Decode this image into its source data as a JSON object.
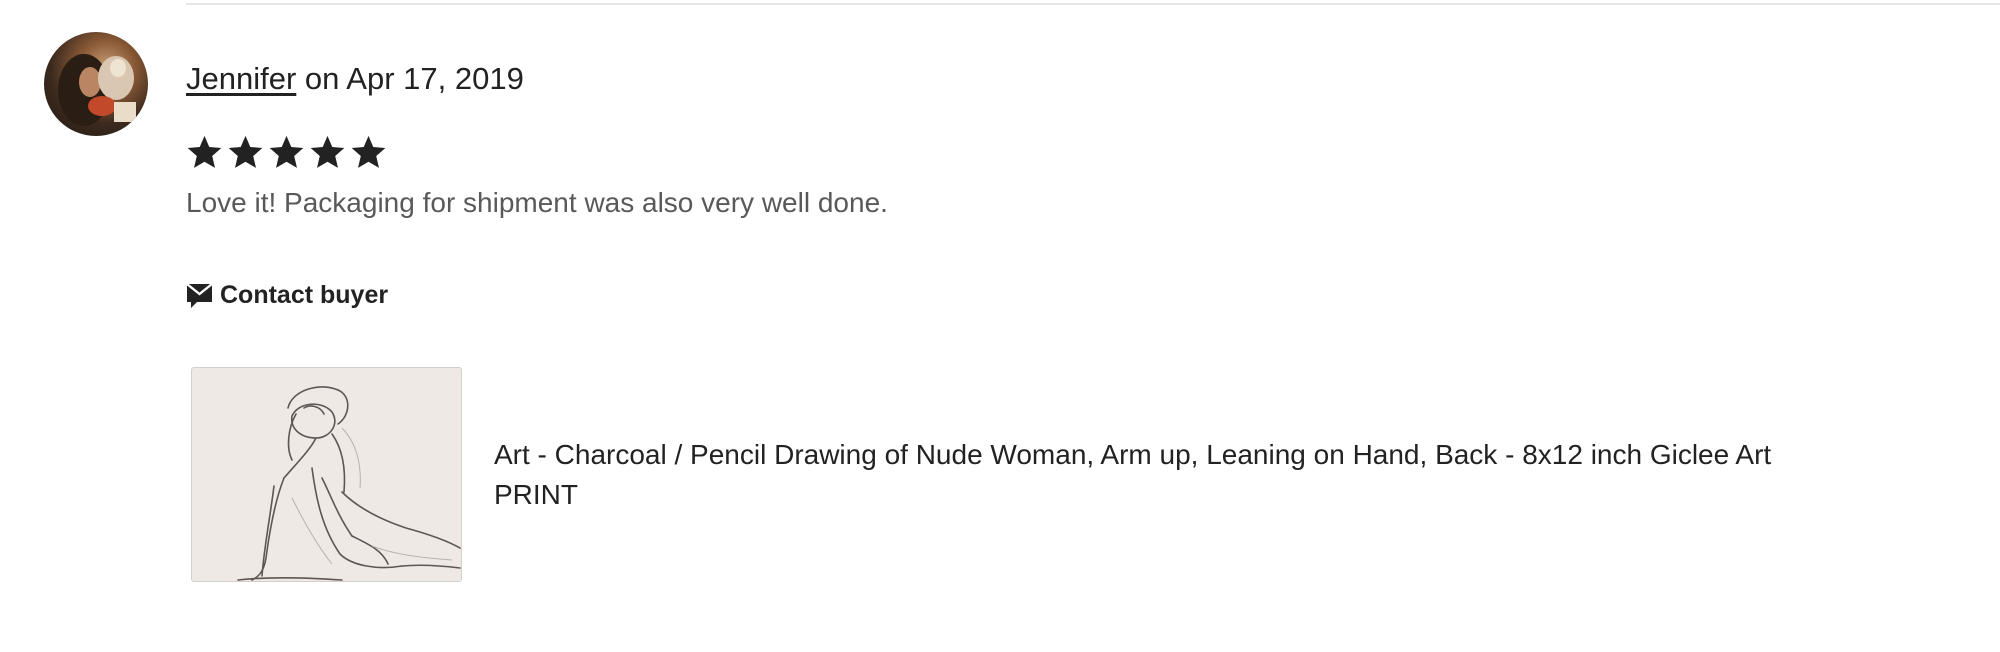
{
  "review": {
    "reviewer_name": "Jennifer",
    "date_text": "on Apr 17, 2019",
    "rating": 5,
    "max_rating": 5,
    "text": "Love it! Packaging for shipment was also very well done."
  },
  "actions": {
    "contact_buyer_label": "Contact buyer"
  },
  "listing": {
    "title": "Art - Charcoal / Pencil Drawing of Nude Woman, Arm up, Leaning on Hand, Back - 8x12 inch Giclee Art PRINT"
  },
  "icons": {
    "star": "star-icon",
    "contact": "message-icon"
  },
  "colors": {
    "text": "#222222",
    "muted_text": "#595959",
    "divider": "#e5e5e5",
    "thumb_bg": "#efe9e6"
  }
}
